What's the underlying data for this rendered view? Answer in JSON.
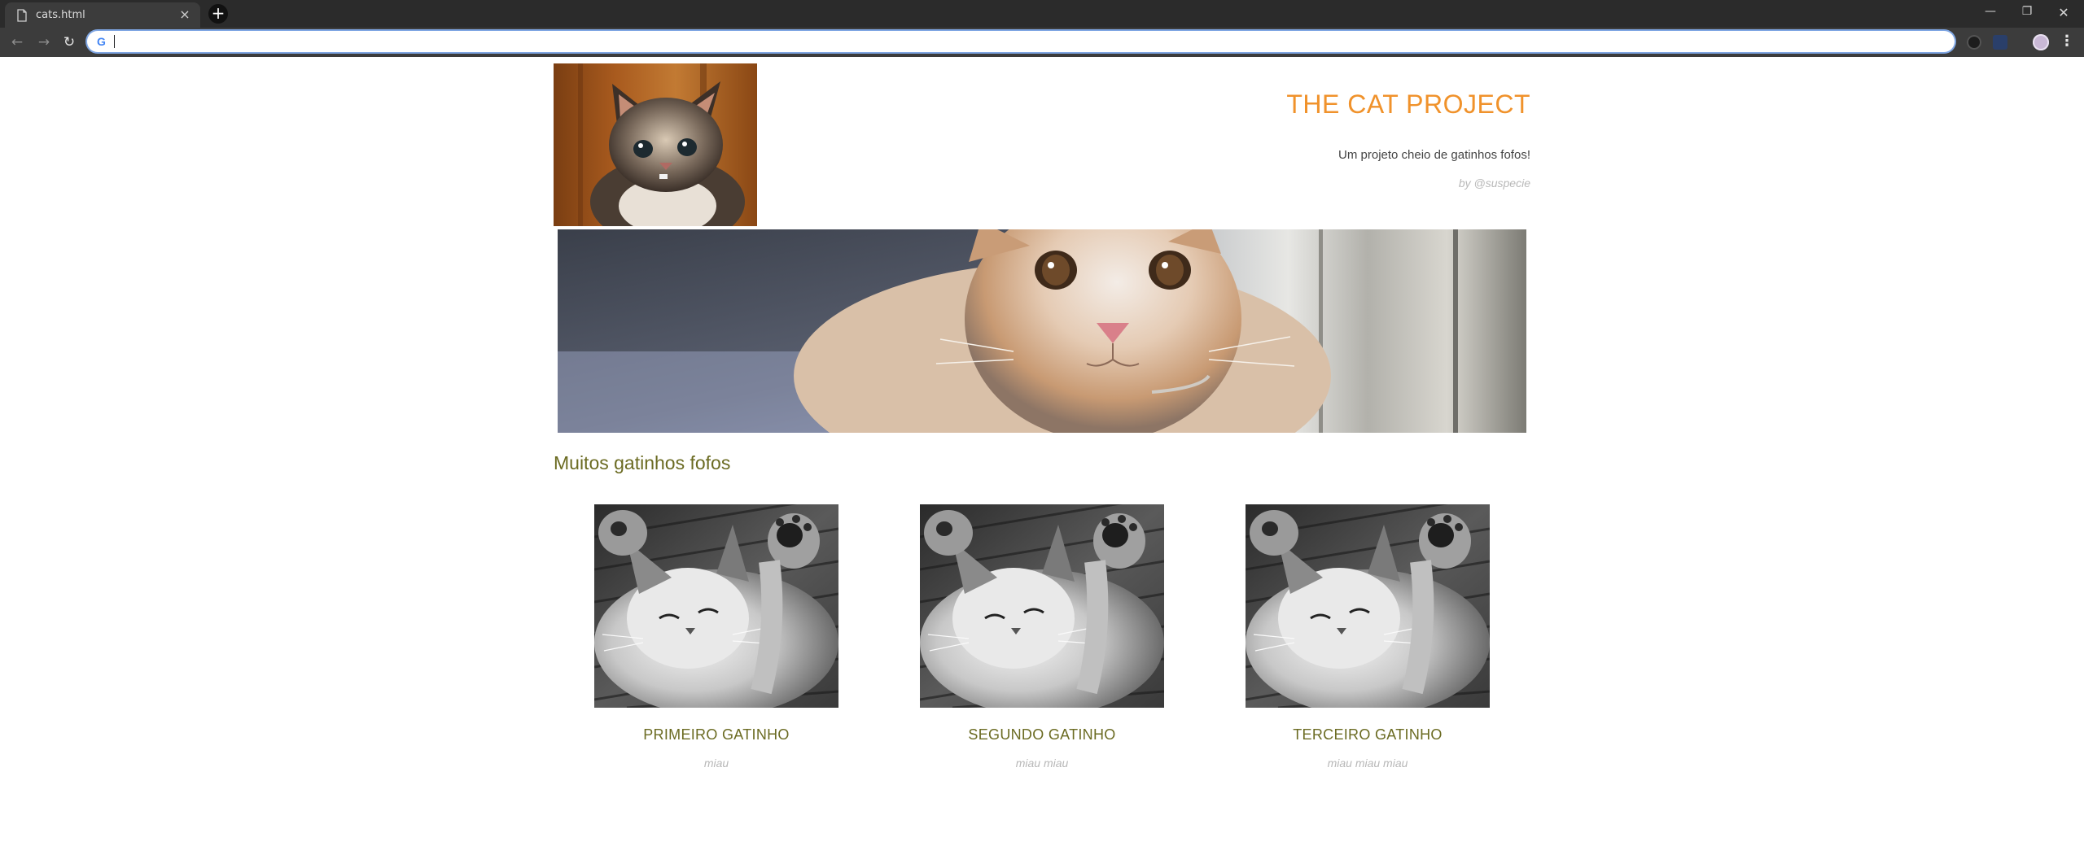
{
  "browser": {
    "tab_title": "cats.html",
    "tab_close_glyph": "×",
    "new_tab_glyph": "+",
    "window_controls": {
      "minimize": "—",
      "maximize": "❐",
      "close": "✕"
    },
    "nav": {
      "back": "←",
      "forward": "→",
      "reload": "↻"
    },
    "address": {
      "value": "",
      "search_engine_icon": "google-icon",
      "search_engine_letter": "G"
    },
    "menu_glyph": "⋮"
  },
  "page": {
    "site_title": "THE CAT PROJECT",
    "tagline": "Um projeto cheio de gatinhos fofos!",
    "byline": "by @suspecie",
    "section_title": "Muitos gatinhos fofos",
    "cards": [
      {
        "title": "PRIMEIRO GATINHO",
        "text": "miau"
      },
      {
        "title": "SEGUNDO GATINHO",
        "text": "miau miau"
      },
      {
        "title": "TERCEIRO GATINHO",
        "text": "miau miau miau"
      }
    ]
  },
  "colors": {
    "title_orange": "#f0922b",
    "olive": "#6b6b22",
    "muted_text": "#b8b8b8",
    "chrome_dark": "#2b2b2b",
    "chrome_toolbar": "#3c3c3c"
  }
}
